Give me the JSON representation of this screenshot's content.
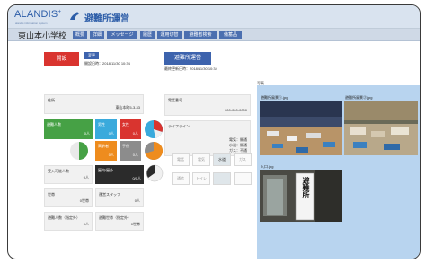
{
  "header": {
    "logo": "ALANDIS",
    "logo_sup": "+",
    "logo_sub": "alandis information system",
    "app_title": "避難所運営"
  },
  "nav": {
    "school": "東山本小学校",
    "tabs": [
      "概要",
      "詳細",
      "メッセージ",
      "履歴",
      "運用切替",
      "避難者検索",
      "備蓄品"
    ]
  },
  "status": {
    "open_label": "開設",
    "change_label": "変更",
    "updated": "開設日時：2018/11/30 10:34",
    "operation_button": "避難所運営",
    "operation_updated": "最終更新日時：2018/11/30 10:34"
  },
  "left": {
    "address_label": "住所",
    "address_value": "東山本町5-3-33",
    "evacuees_label": "避難人数",
    "evacuees_value": "0人",
    "male_label": "男性",
    "male_value": "0人",
    "female_label": "女性",
    "female_value": "0人",
    "elderly_label": "高齢者",
    "elderly_value": "0人",
    "children_label": "子供",
    "children_value": "0人",
    "in_out_label": "屋内/屋外",
    "in_out_value": "0/0人",
    "capacity_label": "受入可能人数",
    "capacity_value": "0人",
    "household_label": "世帯",
    "household_value": "0世帯",
    "staff_label": "運営スタッフ",
    "staff_value": "0人",
    "staff_count_label": "避難所職員",
    "staff_count_value": "0人",
    "headcount_label": "避難人数（指定外）",
    "headcount_value": "0人",
    "headcount2_label": "避難世帯（指定外）",
    "headcount2_value": "0世帯"
  },
  "middle": {
    "phone_label": "電話番号",
    "phone_value": "000-000-0000",
    "lifeline_label": "ライフライン",
    "lifeline_lines": [
      "電気：開通",
      "水道：開通",
      "ガス：不通"
    ],
    "cells": [
      "電話",
      "電気",
      "水道",
      "ガス",
      "通信",
      "トイレ"
    ]
  },
  "photos": {
    "title": "写真",
    "labels": [
      "避難所風景①.jpg",
      "避難所風景②.jpg",
      "入口.jpg"
    ],
    "sign_text": "避難所"
  },
  "colors": {
    "accent": "#3d63ad",
    "alert": "#d9342f",
    "green": "#46a145",
    "cyan": "#3aaadc",
    "orange": "#ee8c1e",
    "panel": "#b8d4ef"
  }
}
